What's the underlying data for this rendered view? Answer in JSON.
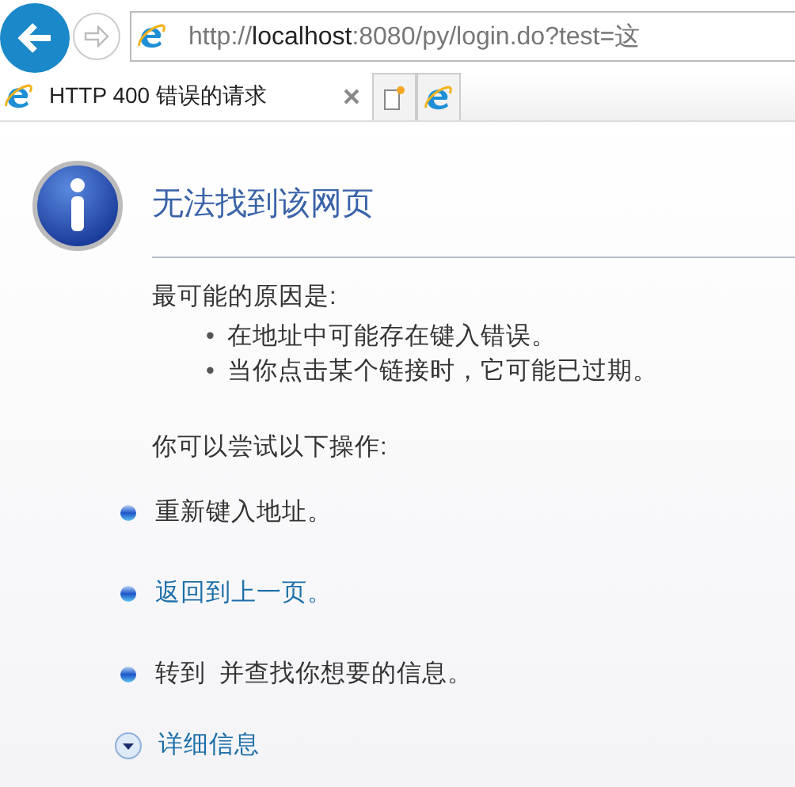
{
  "address_bar": {
    "url": "http://**localhost**:8080/py/login.do?test=这"
  },
  "tabs": [
    {
      "title": "HTTP 400 错误的请求",
      "selected": true
    }
  ],
  "page": {
    "title": "无法找到该网页",
    "causes_heading": "最可能的原因是:",
    "causes": [
      {
        "bullet": "•",
        "text": "在地址中可能存在键入错误。"
      },
      {
        "bullet": "•",
        "text": "当你点击某个链接时，它可能已过期。"
      }
    ],
    "actions_heading": "你可以尝试以下操作:",
    "actions": [
      {
        "kind": "text",
        "label": "重新键入地址。"
      },
      {
        "kind": "link",
        "label": "返回到上一页。"
      },
      {
        "kind": "text",
        "label": "转到  并查找你想要的信息。"
      }
    ],
    "details_link": "详细信息"
  }
}
